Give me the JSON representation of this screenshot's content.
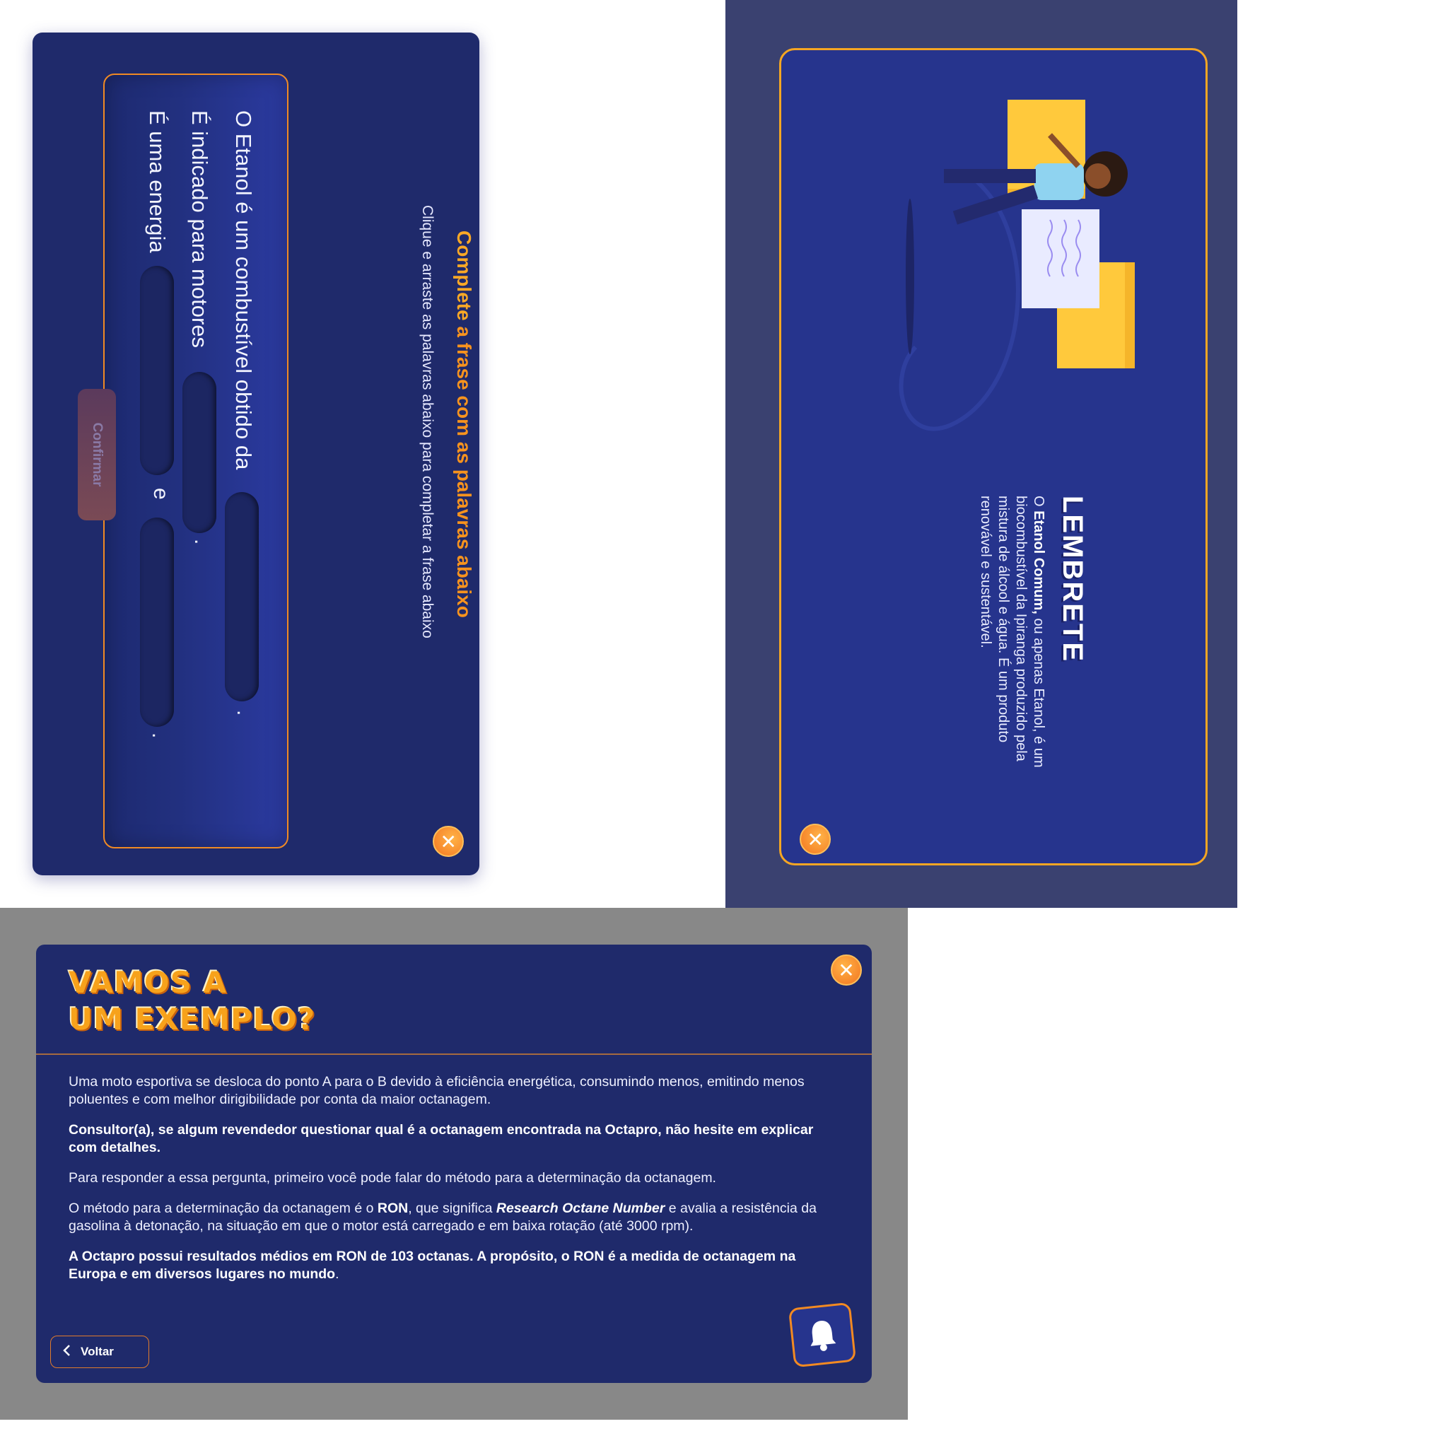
{
  "fill_blank": {
    "title_word": "Complete",
    "title_rest": "a frase com as palavras abaixo",
    "subtitle": "Clique e arraste as palavras abaixo para completar a frase abaixo",
    "line1": "O Etanol é um combustível obtido da",
    "line1_end": ".",
    "line2": "É indicado para motores",
    "line2_end": ".",
    "line3": "É uma energia",
    "line3_mid": "e",
    "line3_end": ".",
    "confirm_label": "Confirmar",
    "close_symbol": "✕"
  },
  "reminder": {
    "title": "LEMBRETE",
    "bold_term": "Etanol Comum,",
    "text_pre": "O",
    "text_post": "ou apenas Etanol, é um biocombustível da Ipiranga produzido pela mistura de álcool e água. É um produto renovável e sustentável.",
    "close_symbol": "✕"
  },
  "example": {
    "title_line1": "VAMOS A",
    "title_line2": "UM EXEMPLO?",
    "p1": "Uma moto esportiva se desloca do ponto A para o B devido à eficiência energética, consumindo menos, emitindo menos poluentes e com melhor dirigibilidade por conta da maior octanagem.",
    "p2": "Consultor(a), se algum revendedor questionar qual é a octanagem encontrada na Octapro, não hesite em explicar com detalhes.",
    "p3": "Para responder a essa pergunta, primeiro você pode falar do método para a determinação da octanagem.",
    "p4_a": "O método para a determinação da octanagem é o",
    "p4_ron": "RON",
    "p4_b": ", que significa",
    "p4_term": "Research Octane Number",
    "p4_c": "e avalia a resistência da gasolina à detonação, na situação em que o motor está carregado e em baixa rotação (até 3000 rpm).",
    "p5": "A Octapro possui resultados médios em RON de 103 octanas. A propósito, o RON é a medida de octanagem na Europa e em diversos lugares no mundo",
    "p5_end": ".",
    "back_label": "Voltar",
    "back_icon": "chevron-left-icon",
    "close_symbol": "✕",
    "bell_icon": "bell-icon"
  },
  "colors": {
    "panel_navy": "#1f2a6b",
    "accent_orange": "#f7931e",
    "accent_yellow": "#f9a826",
    "outer_slate": "#3a4170"
  }
}
